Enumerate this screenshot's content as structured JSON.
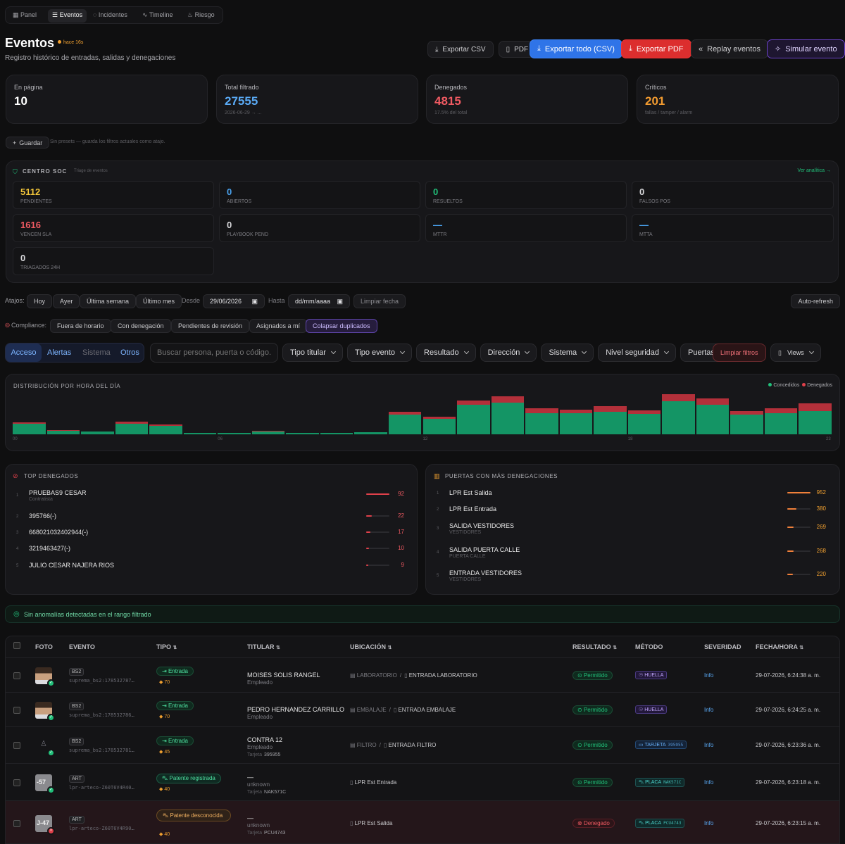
{
  "nav": {
    "tabs": [
      {
        "label": "Panel"
      },
      {
        "label": "Eventos"
      },
      {
        "label": "Incidentes"
      },
      {
        "label": "Timeline"
      },
      {
        "label": "Riesgo"
      }
    ]
  },
  "header": {
    "title": "Eventos",
    "badge": "hace 16s",
    "subtitle": "Registro histórico de entradas, salidas y denegaciones"
  },
  "actions": {
    "export_csv": "Exportar CSV",
    "pdf": "PDF",
    "export_all": "Exportar todo (CSV)",
    "export_pdf": "Exportar PDF",
    "replay": "Replay eventos",
    "simulate": "Simular evento"
  },
  "stats": [
    {
      "label": "En página",
      "value": "10",
      "sub": ""
    },
    {
      "label": "Total filtrado",
      "value": "27555",
      "sub": "2026-06-29 → ..."
    },
    {
      "label": "Denegados",
      "value": "4815",
      "sub": "17.5% del total"
    },
    {
      "label": "Críticos",
      "value": "201",
      "sub": "fallas / tamper / alarm"
    }
  ],
  "presets": {
    "save": "Guardar",
    "hint": "Sin presets — guarda los filtros actuales como atajo."
  },
  "soc": {
    "title": "CENTRO SOC",
    "subtitle": "Triage de eventos",
    "link": "Ver analítica →",
    "cells": [
      {
        "value": "5112",
        "label": "PENDIENTES",
        "color": "#f0c43a"
      },
      {
        "value": "0",
        "label": "ABIERTOS",
        "color": "#4aa3f0"
      },
      {
        "value": "0",
        "label": "RESUELTOS",
        "color": "#21c07a"
      },
      {
        "value": "0",
        "label": "FALSOS POS",
        "color": "#d8d8db"
      },
      {
        "value": "1616",
        "label": "VENCEN SLA",
        "color": "#f05a62"
      },
      {
        "value": "0",
        "label": "PLAYBOOK PEND",
        "color": "#d8d8db"
      },
      {
        "value": "—",
        "label": "MTTR",
        "color": "#4aa3f0"
      },
      {
        "value": "—",
        "label": "MTTA",
        "color": "#4aa3f0"
      },
      {
        "value": "0",
        "label": "TRIAGADOS 24H",
        "color": "#d8d8db"
      }
    ]
  },
  "shortcuts": {
    "label": "Atajos:",
    "items": [
      "Hoy",
      "Ayer",
      "Última semana",
      "Último mes"
    ],
    "from_label": "Desde",
    "from_value": "29/06/2026",
    "to_label": "Hasta",
    "to_value": "dd/mm/aaaa",
    "clear_date": "Limpiar fecha",
    "auto_refresh": "Auto-refresh"
  },
  "compliance": {
    "label": "Compliance:",
    "items": [
      "Fuera de horario",
      "Con denegación",
      "Pendientes de revisión",
      "Asignados a mí",
      "Colapsar duplicados"
    ]
  },
  "category_tabs": [
    "Acceso",
    "Alertas",
    "Sistema",
    "Otros"
  ],
  "search": {
    "placeholder": "Buscar persona, puerta o código."
  },
  "filters": [
    "Tipo titular",
    "Tipo evento",
    "Resultado",
    "Dirección",
    "Sistema",
    "Nivel seguridad",
    "Puertas"
  ],
  "clear_filters": "Limpiar filtros",
  "views": "Views",
  "chart_data": {
    "type": "bar",
    "title": "DISTRIBUCIÓN POR HORA DEL DÍA",
    "legend": [
      "Concedidos",
      "Denegados"
    ],
    "legend_position": "top-right",
    "x_ticks": [
      "00",
      "06",
      "12",
      "18",
      "23"
    ],
    "categories": [
      "00",
      "01",
      "02",
      "03",
      "04",
      "05",
      "06",
      "07",
      "08",
      "09",
      "10",
      "11",
      "12",
      "13",
      "14",
      "15",
      "16",
      "17",
      "18",
      "19",
      "20",
      "21",
      "22",
      "23"
    ],
    "series": [
      {
        "name": "Concedidos",
        "color": "#149565",
        "values": [
          14,
          5,
          4,
          14,
          11,
          2,
          2,
          4,
          2,
          2,
          3,
          26,
          20,
          39,
          42,
          28,
          28,
          30,
          27,
          44,
          39,
          26,
          28,
          31
        ]
      },
      {
        "name": "Denegados",
        "color": "#b3303a",
        "values": [
          2,
          1,
          0,
          3,
          2,
          0,
          0,
          1,
          0,
          0,
          0,
          4,
          3,
          6,
          8,
          6,
          5,
          7,
          5,
          9,
          8,
          5,
          6,
          10
        ]
      }
    ]
  },
  "top_denied": {
    "title": "TOP DENEGADOS",
    "items": [
      {
        "rank": "1",
        "name": "PRUEBAS9 CESAR",
        "sub": "Contratista",
        "count": "92",
        "pct": 1.0
      },
      {
        "rank": "2",
        "name": "395766(-)",
        "sub": "",
        "count": "22",
        "pct": 0.24
      },
      {
        "rank": "3",
        "name": "668021032402944(-)",
        "sub": "",
        "count": "17",
        "pct": 0.18
      },
      {
        "rank": "4",
        "name": "3219463427(-)",
        "sub": "",
        "count": "10",
        "pct": 0.11
      },
      {
        "rank": "5",
        "name": "JULIO CESAR NAJERA RIOS",
        "sub": "",
        "count": "9",
        "pct": 0.1
      }
    ]
  },
  "top_doors": {
    "title": "PUERTAS CON MÁS DENEGACIONES",
    "items": [
      {
        "rank": "1",
        "name": "LPR Est Salida",
        "sub": "",
        "count": "952",
        "pct": 1.0
      },
      {
        "rank": "2",
        "name": "LPR Est Entrada",
        "sub": "",
        "count": "380",
        "pct": 0.4
      },
      {
        "rank": "3",
        "name": "SALIDA VESTIDORES",
        "sub": "VESTIDORES",
        "count": "269",
        "pct": 0.28
      },
      {
        "rank": "4",
        "name": "SALIDA PUERTA CALLE",
        "sub": "PUERTA CALLE",
        "count": "268",
        "pct": 0.28
      },
      {
        "rank": "5",
        "name": "ENTRADA VESTIDORES",
        "sub": "VESTIDORES",
        "count": "220",
        "pct": 0.23
      }
    ]
  },
  "anomaly": "Sin anomalías detectadas en el rango filtrado",
  "table": {
    "headers": {
      "photo": "FOTO",
      "event": "EVENTO",
      "type": "TIPO",
      "holder": "TITULAR",
      "location": "UBICACIÓN",
      "result": "RESULTADO",
      "method": "MÉTODO",
      "severity": "SEVERIDAD",
      "datetime": "FECHA/HORA"
    },
    "rows": [
      {
        "src": "BS2",
        "code": "suprema_bs2:178532787…",
        "type": "Entrada",
        "score": "70",
        "name": "MOISES SOLIS RANGEL",
        "role": "Empleado",
        "card_label": "",
        "card": "",
        "area": "LABORATORIO",
        "door": "ENTRADA LABORATORIO",
        "result": "Permitido",
        "method": "HUELLA",
        "method_val": "",
        "severity": "Info",
        "datetime": "29-07-2026, 6:24:38 a. m.",
        "photo": "face",
        "denied": false
      },
      {
        "src": "BS2",
        "code": "suprema_bs2:178532786…",
        "type": "Entrada",
        "score": "70",
        "name": "PEDRO HERNANDEZ CARRILLO",
        "role": "Empleado",
        "card_label": "",
        "card": "",
        "area": "EMBALAJE",
        "door": "ENTRADA EMBALAJE",
        "result": "Permitido",
        "method": "HUELLA",
        "method_val": "",
        "severity": "Info",
        "datetime": "29-07-2026, 6:24:25 a. m.",
        "photo": "face",
        "denied": false
      },
      {
        "src": "BS2",
        "code": "suprema_bs2:178532781…",
        "type": "Entrada",
        "score": "45",
        "name": "CONTRA 12",
        "role": "Empleado",
        "card_label": "Tarjeta",
        "card": "395955",
        "area": "FILTRO",
        "door": "ENTRADA FILTRO",
        "result": "Permitido",
        "method": "TARJETA",
        "method_val": "395955",
        "severity": "Info",
        "datetime": "29-07-2026, 6:23:36 a. m.",
        "photo": "none",
        "denied": false
      },
      {
        "src": "ART",
        "code": "lpr-arteco-Z60T6V4R40…",
        "type": "Patente registrada",
        "score": "40",
        "name": "—",
        "role": "unknown",
        "card_label": "Tarjeta",
        "card": "NAK571C",
        "area": "",
        "door": "LPR Est Entrada",
        "result": "Permitido",
        "method": "PLACA",
        "method_val": "NAK571C",
        "severity": "Info",
        "datetime": "29-07-2026, 6:23:18 a. m.",
        "photo": "plate",
        "denied": false
      },
      {
        "src": "ART",
        "code": "lpr-arteco-Z60T6V4R90…",
        "type": "Patente desconocida",
        "score": "40",
        "name": "—",
        "role": "unknown",
        "card_label": "Tarjeta",
        "card": "PCU4743",
        "area": "",
        "door": "LPR Est Salida",
        "result": "Denegado",
        "method": "PLACA",
        "method_val": "PCU4743",
        "severity": "Info",
        "datetime": "29-07-2026, 6:23:15 a. m.",
        "photo": "plate2",
        "denied": true
      }
    ]
  }
}
